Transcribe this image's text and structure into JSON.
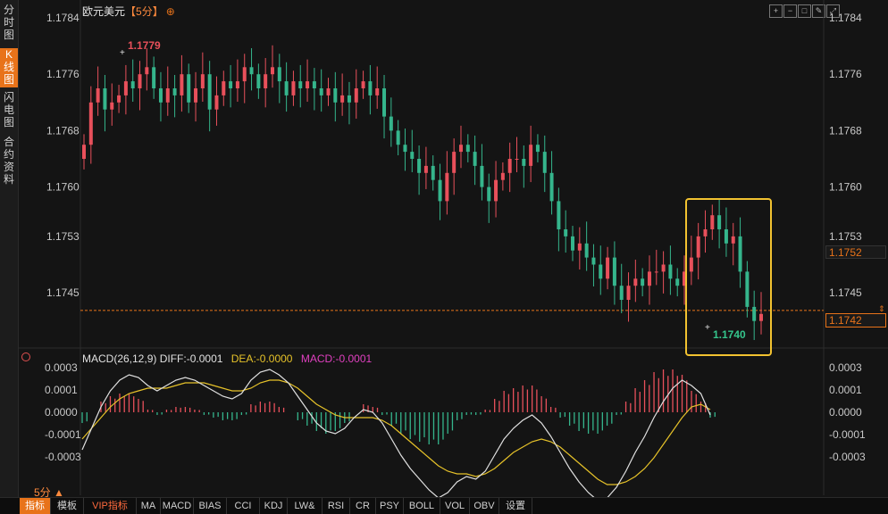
{
  "sidebar": {
    "tabs": [
      {
        "label": "分时图"
      },
      {
        "label": "K线图"
      },
      {
        "label": "闪电图"
      },
      {
        "label": "合约资料"
      }
    ]
  },
  "header": {
    "symbol": "欧元美元",
    "period": "【5分】",
    "gear_icon": "⊕"
  },
  "colors": {
    "up": "#e8505b",
    "down": "#35b58c",
    "diff_line": "#e0e0e0",
    "dea_line": "#e6c229",
    "highlight_box": "#f2c230",
    "current_price": "#e8731a"
  },
  "chart_data": [
    {
      "type": "candlestick",
      "title": "欧元美元【5分】",
      "y_ticks": [
        "1.1784",
        "1.1776",
        "1.1768",
        "1.1760",
        "1.1753",
        "1.1745"
      ],
      "ylim": [
        1.1738,
        1.1785
      ],
      "high_annotation": "1.1779",
      "low_annotation": "1.1740",
      "last_price_label": "1.1752",
      "current_price_label": "1.1742",
      "current_price": 1.17425,
      "closes": [
        1.1766,
        1.1772,
        1.1774,
        1.1771,
        1.1772,
        1.1773,
        1.1775,
        1.1774,
        1.1776,
        1.1777,
        1.1774,
        1.1772,
        1.1774,
        1.1773,
        1.1776,
        1.1772,
        1.1774,
        1.1776,
        1.1771,
        1.1773,
        1.1775,
        1.1774,
        1.1775,
        1.1777,
        1.1776,
        1.1774,
        1.1776,
        1.1777,
        1.1775,
        1.1773,
        1.1775,
        1.1774,
        1.1775,
        1.1774,
        1.1773,
        1.1774,
        1.1772,
        1.1773,
        1.1772,
        1.1774,
        1.1775,
        1.1773,
        1.1774,
        1.177,
        1.1768,
        1.1766,
        1.1765,
        1.1764,
        1.1762,
        1.1763,
        1.1761,
        1.1758,
        1.1762,
        1.1765,
        1.1766,
        1.1765,
        1.1763,
        1.176,
        1.1758,
        1.1761,
        1.1762,
        1.1764,
        1.1764,
        1.1763,
        1.1766,
        1.1765,
        1.1762,
        1.1758,
        1.1754,
        1.1753,
        1.1751,
        1.1752,
        1.175,
        1.1749,
        1.1747,
        1.175,
        1.1746,
        1.1744,
        1.1746,
        1.1747,
        1.1746,
        1.1748,
        1.1748,
        1.1749,
        1.1747,
        1.1746,
        1.1748,
        1.175,
        1.1753,
        1.1754,
        1.1756,
        1.1754,
        1.1752,
        1.1753,
        1.1748,
        1.1743,
        1.1741,
        1.1742
      ],
      "x_label": "5分"
    },
    {
      "type": "macd",
      "label": "MACD(26,12,9)",
      "diff_label": "DIFF:-0.0001",
      "dea_label": "DEA:-0.0000",
      "macd_label": "MACD:-0.0001",
      "y_ticks": [
        "0.0003",
        "0.0001",
        "0.0000",
        "-0.0001",
        "-0.0003"
      ],
      "ylim": [
        -0.00032,
        0.00036
      ],
      "diff": [
        -0.00014,
        -6e-05,
        2e-05,
        8e-05,
        0.00012,
        0.00014,
        0.00013,
        0.0001,
        8e-05,
        0.0001,
        0.00012,
        0.00013,
        0.00012,
        0.0001,
        8e-05,
        6e-05,
        5e-05,
        7e-05,
        0.00012,
        0.00015,
        0.00016,
        0.00014,
        0.00011,
        6e-05,
        1e-05,
        -4e-05,
        -7e-05,
        -8e-05,
        -6e-05,
        -2e-05,
        1e-05,
        0.0,
        -4e-05,
        -0.0001,
        -0.00016,
        -0.00021,
        -0.00025,
        -0.00029,
        -0.00032,
        -0.0003,
        -0.00026,
        -0.00024,
        -0.00025,
        -0.00022,
        -0.00016,
        -0.0001,
        -6e-05,
        -3e-05,
        -1e-05,
        -4e-05,
        -9e-05,
        -0.00015,
        -0.00021,
        -0.00026,
        -0.0003,
        -0.00033,
        -0.00032,
        -0.00028,
        -0.00022,
        -0.00015,
        -9e-05,
        -2e-05,
        4e-05,
        9e-05,
        0.00012,
        0.0001,
        7e-05,
        -1e-05
      ],
      "dea": [
        -0.0001,
        -6e-05,
        -2e-05,
        2e-05,
        5e-05,
        7e-05,
        8e-05,
        9e-05,
        9e-05,
        9e-05,
        0.0001,
        0.00011,
        0.00011,
        0.00011,
        0.0001,
        9e-05,
        8e-05,
        8e-05,
        9e-05,
        0.00011,
        0.00012,
        0.00012,
        0.00011,
        9e-05,
        6e-05,
        3e-05,
        1e-05,
        -1e-05,
        -2e-05,
        -2e-05,
        -2e-05,
        -2e-05,
        -3e-05,
        -5e-05,
        -8e-05,
        -0.00011,
        -0.00014,
        -0.00017,
        -0.0002,
        -0.00022,
        -0.00023,
        -0.00023,
        -0.00024,
        -0.00023,
        -0.00021,
        -0.00018,
        -0.00015,
        -0.00013,
        -0.00011,
        -0.0001,
        -0.00011,
        -0.00013,
        -0.00016,
        -0.00019,
        -0.00022,
        -0.00025,
        -0.00027,
        -0.00027,
        -0.00026,
        -0.00024,
        -0.00021,
        -0.00017,
        -0.00012,
        -7e-05,
        -2e-05,
        2e-05,
        3e-05,
        1e-05
      ],
      "hist": [
        -4e-05,
        0.0,
        4e-05,
        6e-05,
        7e-05,
        7e-05,
        5e-05,
        1e-05,
        -1e-05,
        1e-05,
        2e-05,
        2e-05,
        1e-05,
        -1e-05,
        -2e-05,
        -3e-05,
        -3e-05,
        -1e-05,
        3e-05,
        4e-05,
        4e-05,
        2e-05,
        0.0,
        -3e-05,
        -5e-05,
        -7e-05,
        -8e-05,
        -7e-05,
        -4e-05,
        0.0,
        3e-05,
        2e-05,
        -1e-05,
        -5e-05,
        -8e-05,
        -0.0001,
        -0.00011,
        -0.00012,
        -0.00012,
        -8e-05,
        -3e-05,
        -1e-05,
        -1e-05,
        1e-05,
        5e-05,
        8e-05,
        9e-05,
        0.0001,
        0.0001,
        6e-05,
        2e-05,
        -2e-05,
        -5e-05,
        -7e-05,
        -8e-05,
        -8e-05,
        -5e-05,
        -1e-05,
        4e-05,
        9e-05,
        0.00012,
        0.00015,
        0.00016,
        0.00016,
        0.00014,
        8e-05,
        4e-05,
        -2e-05
      ]
    }
  ],
  "bottom_tabs": [
    "指标",
    "模板",
    "VIP指标",
    "MA",
    "MACD",
    "BIAS",
    "CCI",
    "KDJ",
    "LW&",
    "RSI",
    "CR",
    "PSY",
    "BOLL",
    "VOL",
    "OBV",
    "设置"
  ]
}
